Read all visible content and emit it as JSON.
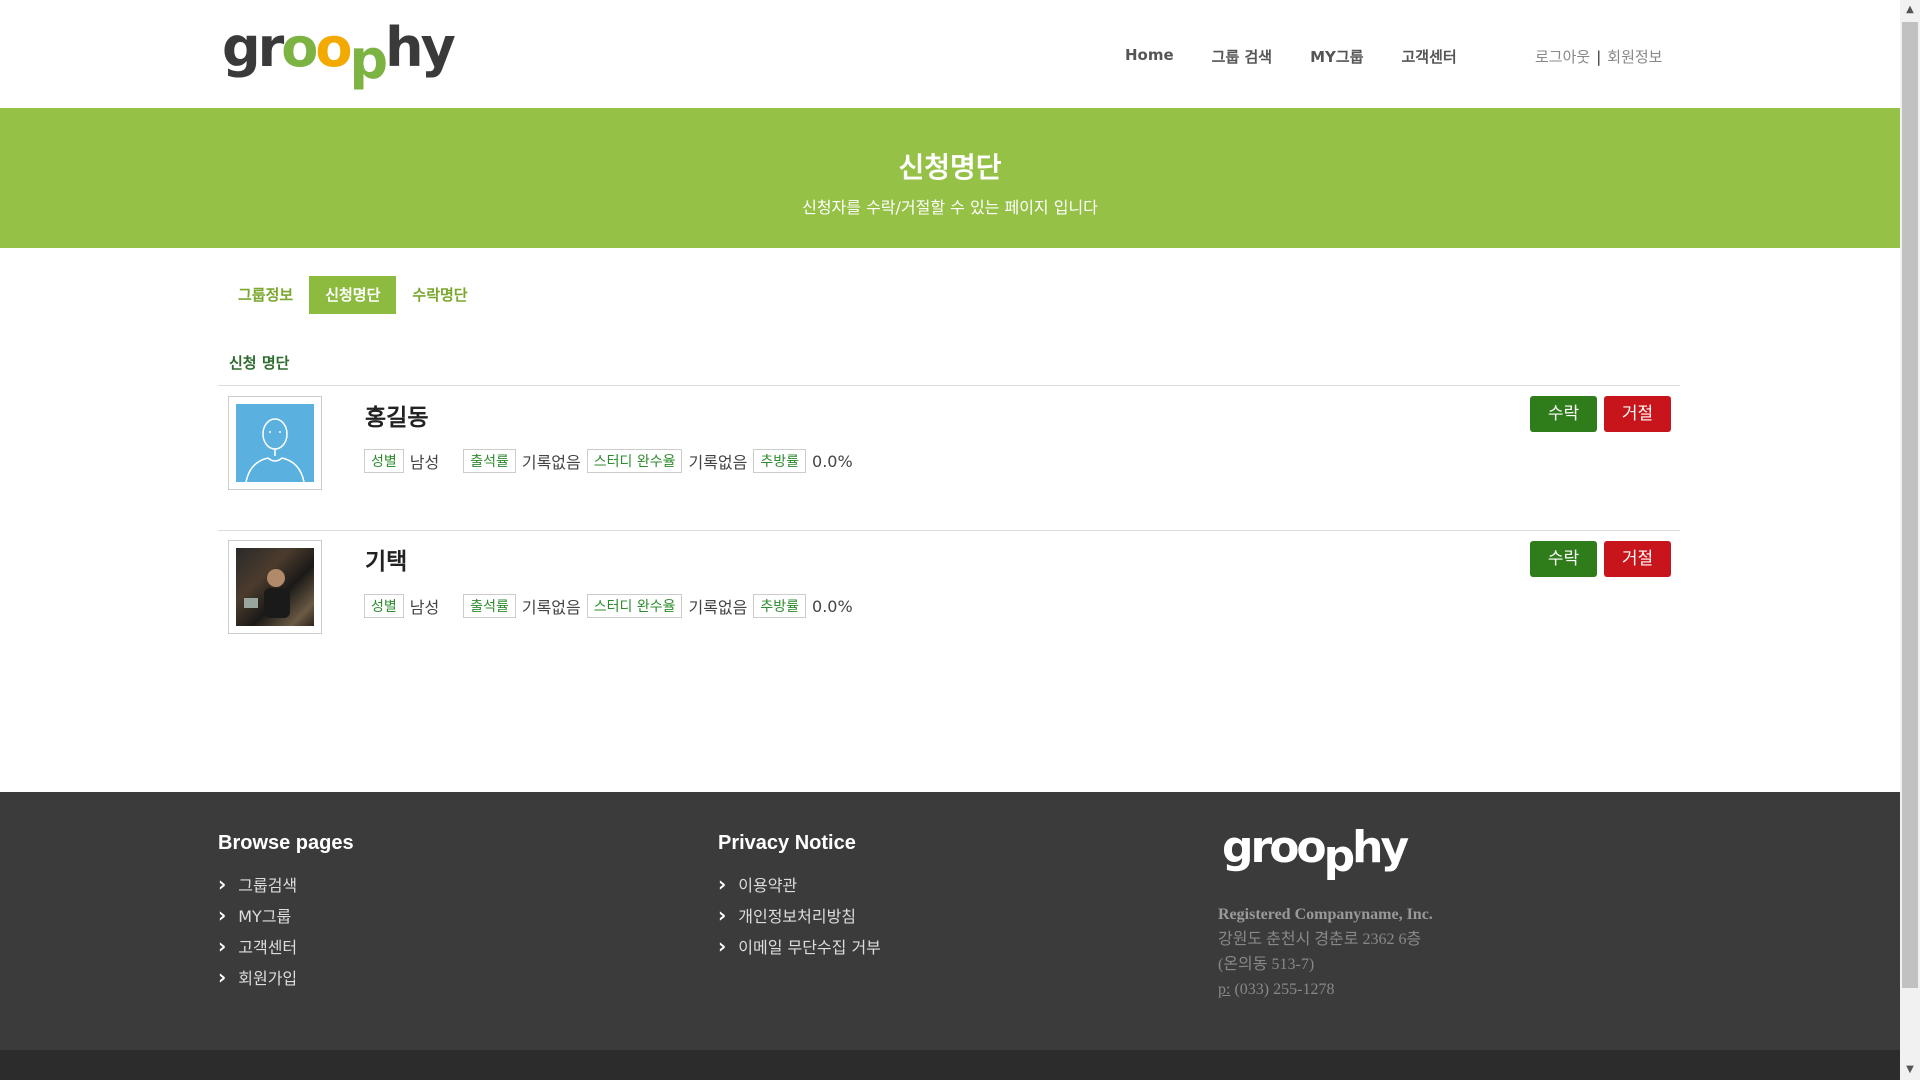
{
  "header": {
    "logo": "groophy",
    "nav": [
      "Home",
      "그룹 검색",
      "MY그룹",
      "고객센터"
    ],
    "logout": "로그아웃",
    "separator": "|",
    "member_info": "회원정보"
  },
  "banner": {
    "title": "신청명단",
    "subtitle": "신청자를 수락/거절할 수 있는 페이지 입니다"
  },
  "tabs": [
    {
      "label": "그룹정보",
      "active": false
    },
    {
      "label": "신청명단",
      "active": true
    },
    {
      "label": "수락명단",
      "active": false
    }
  ],
  "section_title": "신청 명단",
  "stat_labels": {
    "gender": "성별",
    "attendance": "출석률",
    "completion": "스터디 완수율",
    "expel": "추방률"
  },
  "members": [
    {
      "name": "홍길동",
      "gender": "남성",
      "attendance": "기록없음",
      "completion": "기록없음",
      "expel": "0.0%",
      "avatar": "default-avatar"
    },
    {
      "name": "기택",
      "gender": "남성",
      "attendance": "기록없음",
      "completion": "기록없음",
      "expel": "0.0%",
      "avatar": "photo"
    }
  ],
  "buttons": {
    "accept": "수락",
    "reject": "거절"
  },
  "footer": {
    "browse_title": "Browse pages",
    "browse_links": [
      "그룹검색",
      "MY그룹",
      "고객센터",
      "회원가입"
    ],
    "privacy_title": "Privacy Notice",
    "privacy_links": [
      "이용약관",
      "개인정보처리방침",
      "이메일 무단수집 거부"
    ],
    "company": "Registered Companyname, Inc.",
    "address1": "강원도 춘천시 경춘로 2362 6층",
    "address2": "(온의동 513-7)",
    "phone_label": "p:",
    "phone": "(033) 255-1278"
  },
  "colors": {
    "accent": "#95c146",
    "accept": "#2f7d1a",
    "reject": "#c8151b",
    "footer": "#3b3b3b"
  }
}
